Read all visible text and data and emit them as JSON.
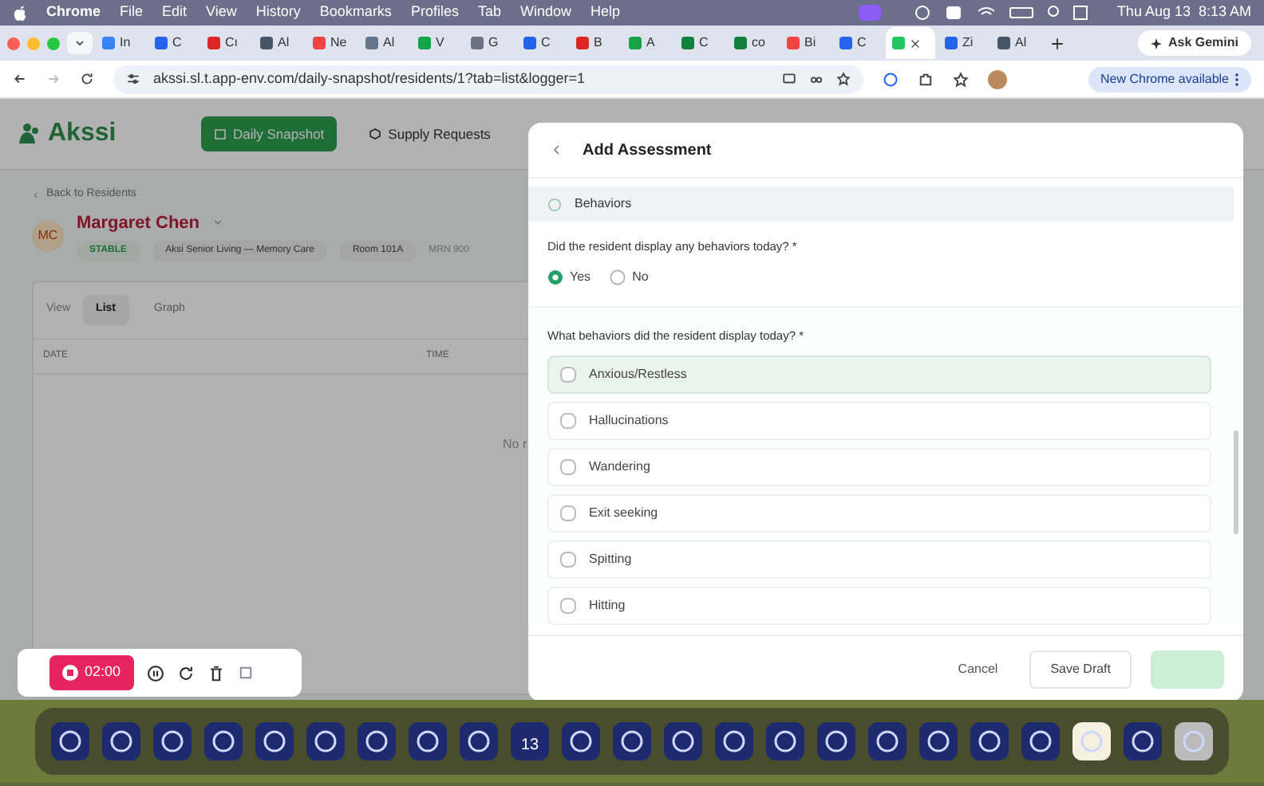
{
  "menu_bar": {
    "app": "Chrome",
    "items": [
      "File",
      "Edit",
      "View",
      "History",
      "Bookmarks",
      "Profiles",
      "Tab",
      "Window",
      "Help"
    ],
    "clock": "Thu Aug 13  8:13 AM"
  },
  "tabs": [
    {
      "label": "In",
      "selected": false
    },
    {
      "label": "C",
      "selected": false
    },
    {
      "label": "Cı",
      "selected": false
    },
    {
      "label": "Al",
      "selected": false
    },
    {
      "label": "Ne",
      "selected": false
    },
    {
      "label": "Al",
      "selected": false
    },
    {
      "label": "V",
      "selected": false
    },
    {
      "label": "G",
      "selected": false
    },
    {
      "label": "C",
      "selected": false
    },
    {
      "label": "B",
      "selected": false
    },
    {
      "label": "A",
      "selected": false
    },
    {
      "label": "C",
      "selected": false
    },
    {
      "label": "co",
      "selected": false
    },
    {
      "label": "Bi",
      "selected": false
    },
    {
      "label": "C",
      "selected": false
    },
    {
      "selected": true
    },
    {
      "label": "Zi",
      "selected": false
    },
    {
      "label": "Al",
      "selected": false
    }
  ],
  "ask_gemini": "Ask Gemini",
  "url": "akssi.sl.t.app-env.com/daily-snapshot/residents/1?tab=list&logger=1",
  "update_badge": "New Chrome available",
  "app": {
    "logo": "Akssi",
    "nav": [
      {
        "label": "Daily Snapshot",
        "selected": true
      },
      {
        "label": "Supply Requests",
        "selected": false
      }
    ],
    "back_link": "Back to Residents",
    "avatar": "MC",
    "resident_name": "Margaret Chen",
    "chips": [
      {
        "label": "STABLE",
        "kind": "status"
      },
      {
        "label": "Aksi Senior Living — Memory Care",
        "kind": "plain"
      },
      {
        "label": "Room 101A",
        "kind": "plain"
      },
      {
        "label": "MRN 900",
        "kind": "text"
      }
    ],
    "view_label": "View",
    "view_tabs": [
      {
        "label": "List",
        "selected": true
      },
      {
        "label": "Graph",
        "selected": false
      }
    ],
    "table": {
      "columns": [
        "DATE",
        "TIME"
      ],
      "empty_text": "No r"
    }
  },
  "recorder": {
    "time": "02:00"
  },
  "modal": {
    "title": "Add Assessment",
    "section": "Behaviors",
    "question_1": "Did the resident display any behaviors today? *",
    "radios": [
      {
        "label": "Yes",
        "selected": true
      },
      {
        "label": "No",
        "selected": false
      }
    ],
    "question_2": "What behaviors did the resident display today? *",
    "options": [
      {
        "label": "Anxious/Restless",
        "checked": false,
        "hovered": true
      },
      {
        "label": "Hallucinations",
        "checked": false,
        "hovered": false
      },
      {
        "label": "Wandering",
        "checked": false,
        "hovered": false
      },
      {
        "label": "Exit seeking",
        "checked": false,
        "hovered": false
      },
      {
        "label": "Spitting",
        "checked": false,
        "hovered": false
      },
      {
        "label": "Hitting",
        "checked": false,
        "hovered": false
      }
    ],
    "cancel": "Cancel",
    "save_draft": "Save Draft",
    "submit_disabled": true
  },
  "dock": {
    "calendar_day": "13"
  }
}
